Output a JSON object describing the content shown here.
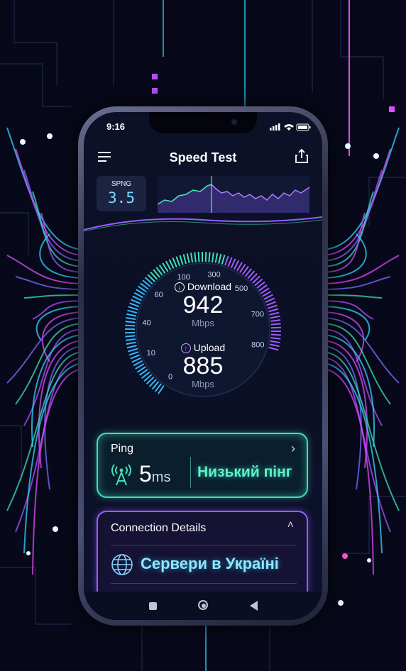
{
  "status_bar": {
    "time": "9:16"
  },
  "header": {
    "title": "Speed Test",
    "menu_icon": "menu-icon",
    "share_icon": "share-icon"
  },
  "spng": {
    "label": "SPNG",
    "value": "3.5"
  },
  "gauge": {
    "ticks": [
      "0",
      "10",
      "40",
      "60",
      "100",
      "300",
      "500",
      "700",
      "800"
    ],
    "download": {
      "label": "Download",
      "value": "942",
      "unit": "Mbps"
    },
    "upload": {
      "label": "Upload",
      "value": "885",
      "unit": "Mbps"
    }
  },
  "ping": {
    "title": "Ping",
    "value": "5",
    "unit": "ms",
    "status": "Низький пінг"
  },
  "connection": {
    "title": "Connection Details",
    "server": "Сервери в Україні"
  },
  "colors": {
    "teal": "#3fe0b8",
    "purple": "#9a5cff",
    "cyan": "#33d6ff",
    "pink": "#e04bff"
  }
}
